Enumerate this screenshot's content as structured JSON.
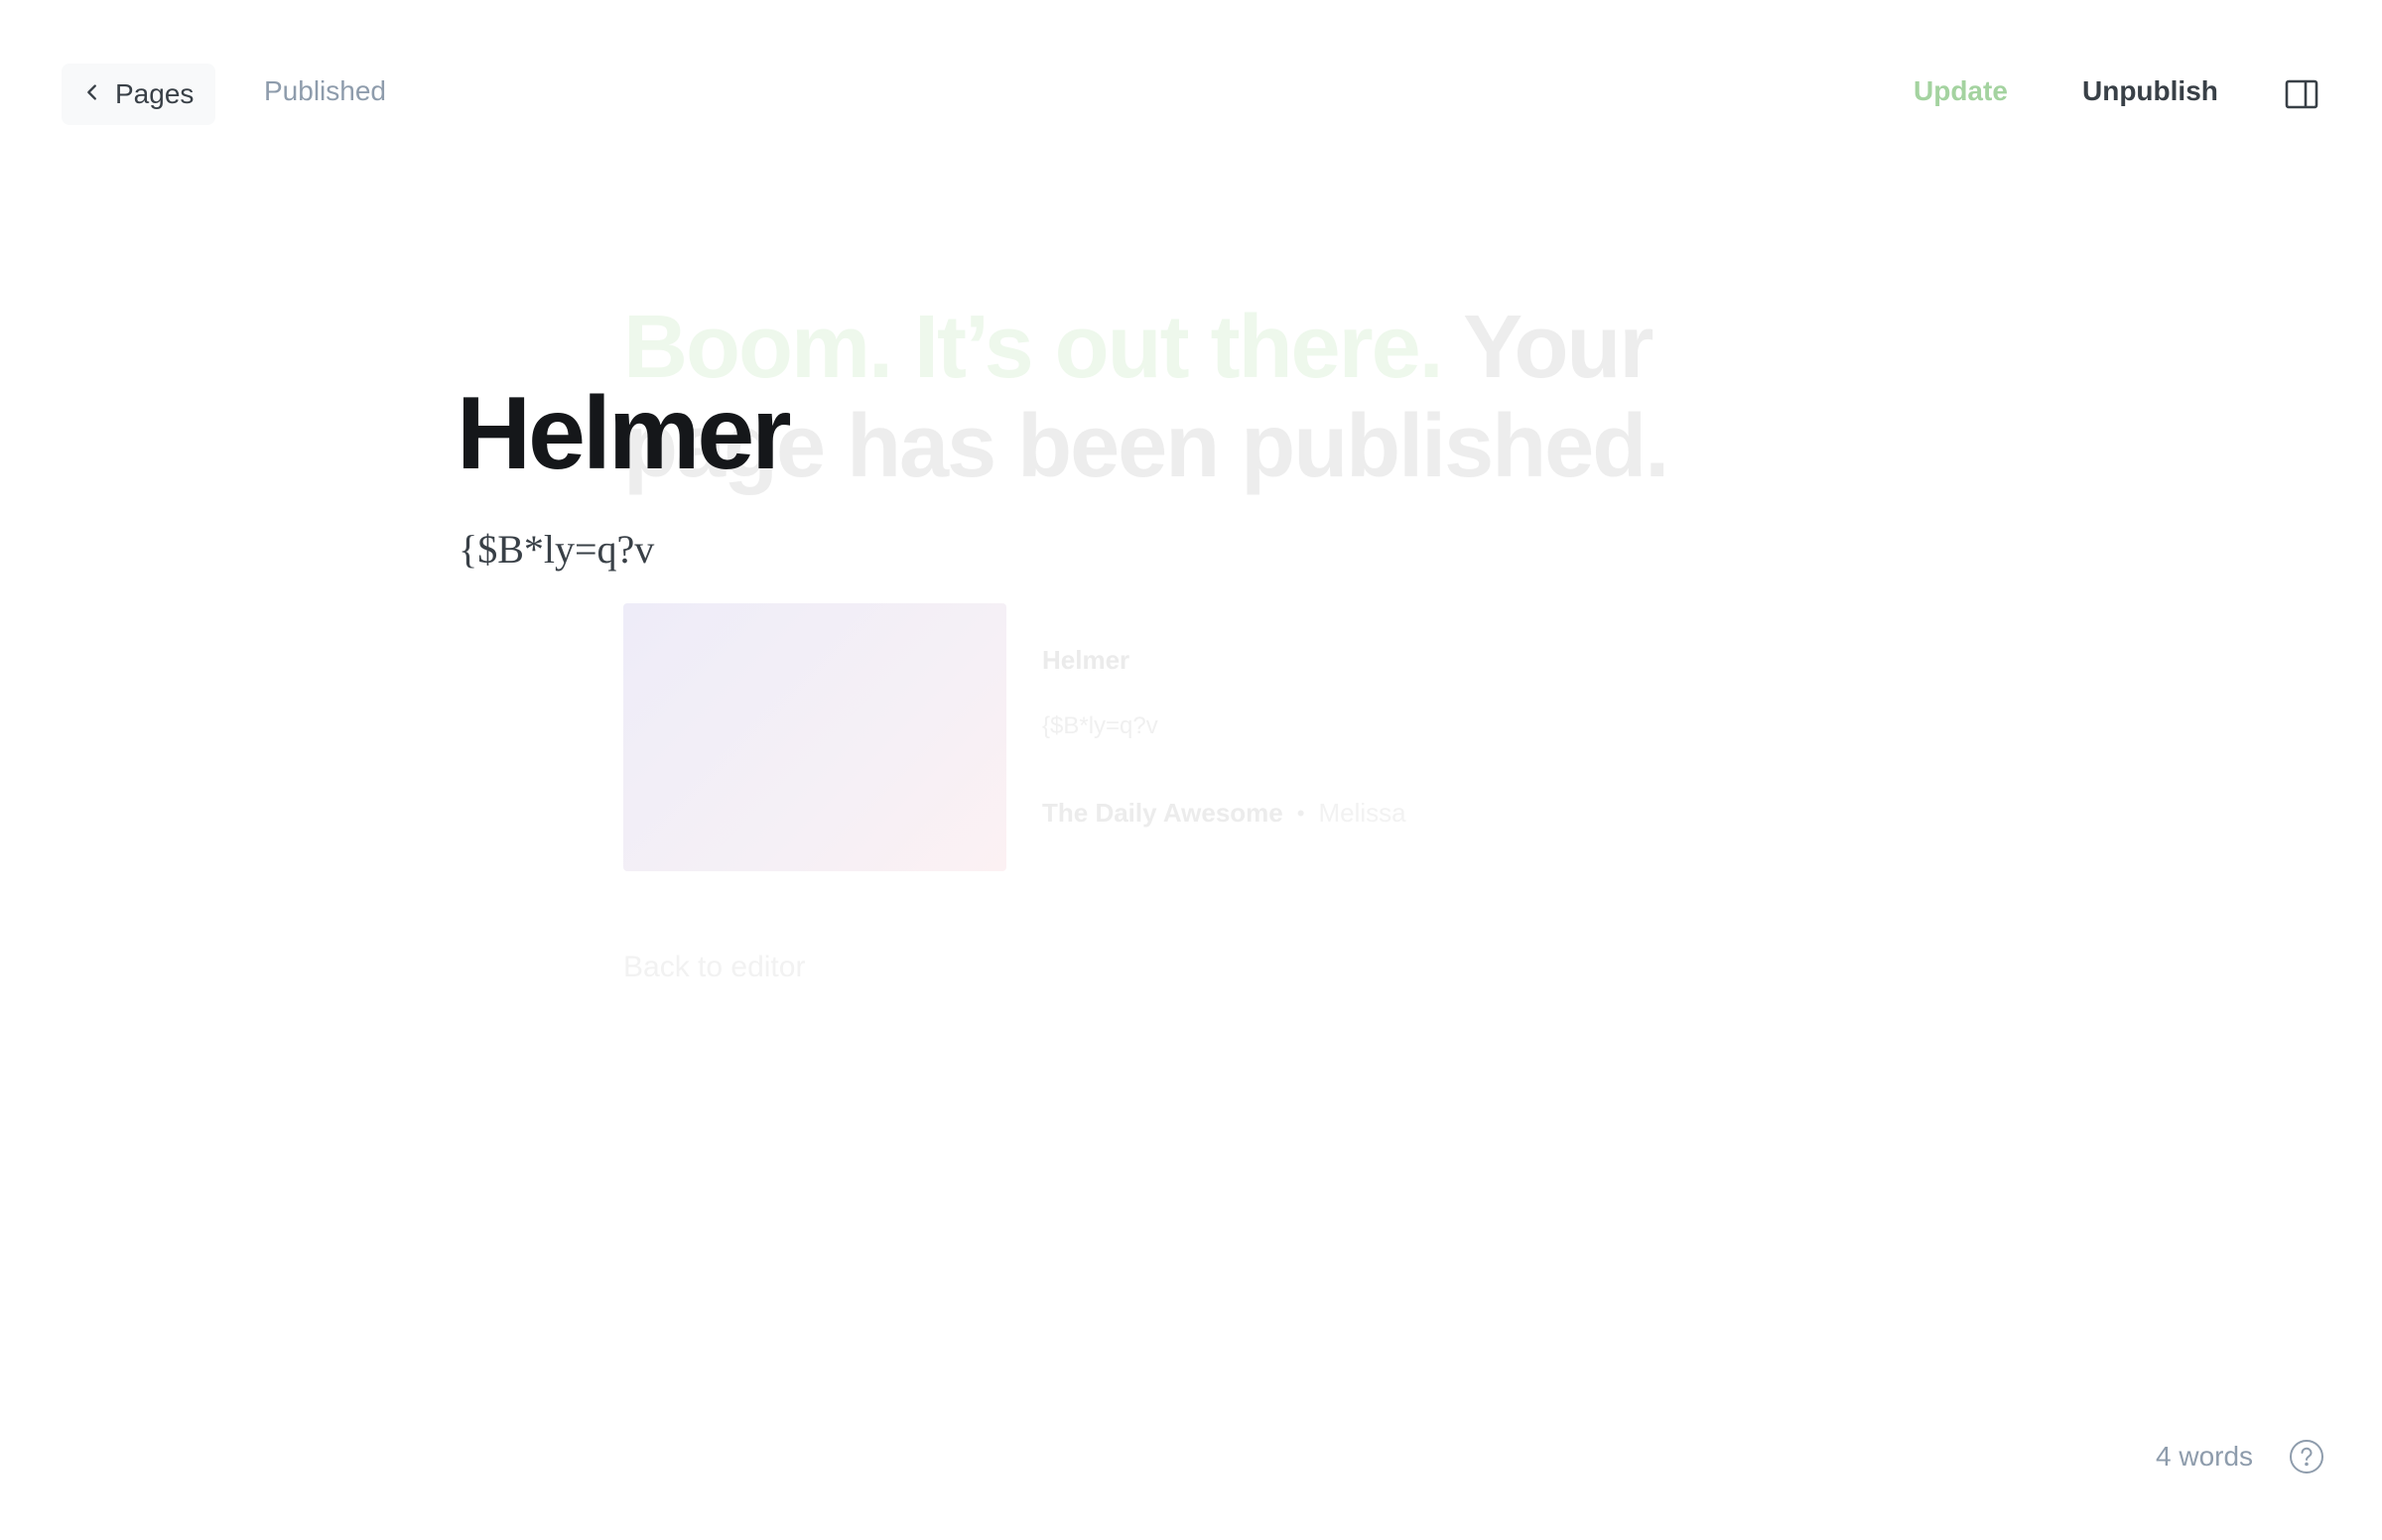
{
  "header": {
    "back_label": "Pages",
    "status": "Published",
    "update_label": "Update",
    "unpublish_label": "Unpublish"
  },
  "editor": {
    "title": "Helmer",
    "excerpt": "{$B*ly=q?v"
  },
  "published_modal": {
    "heading_accent": "Boom. It’s out there.",
    "heading_rest": "Your page has been published.",
    "card": {
      "title": "Helmer",
      "excerpt": "{$B*ly=q?v",
      "publication": "The Daily Awesome",
      "separator": "•",
      "author": "Melissa"
    },
    "back_to_editor": "Back to editor"
  },
  "footer": {
    "word_count": "4 words"
  },
  "icons": {
    "back": "chevron-left-icon",
    "sidebar": "sidebar-toggle-icon",
    "help": "question-circle-icon"
  },
  "colors": {
    "accent_green": "#a4d3a0",
    "muted_text": "#8e9cac",
    "dark_text": "#15171a"
  }
}
